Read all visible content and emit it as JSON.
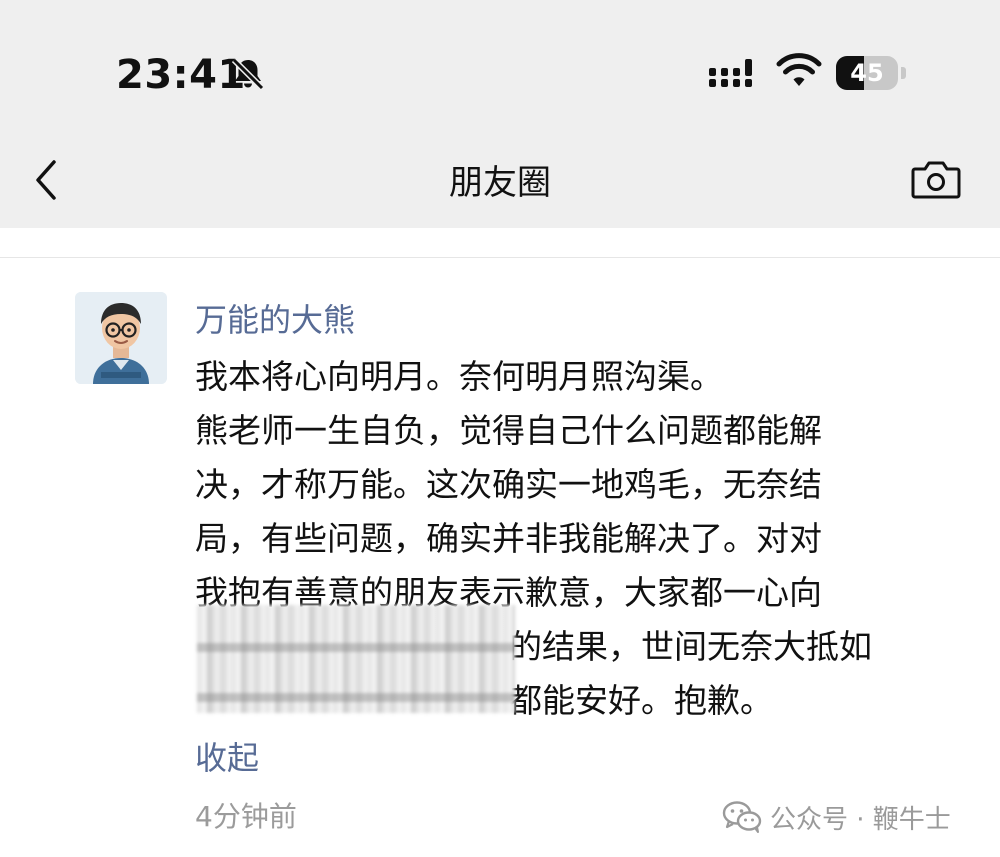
{
  "status_bar": {
    "time": "23:41",
    "battery_percent": 45,
    "battery_label": "45",
    "icons": [
      "bell-muted-icon",
      "signal-icon",
      "wifi-icon",
      "battery-icon"
    ]
  },
  "nav": {
    "title": "朋友圈",
    "back_icon": "chevron-left-icon",
    "camera_icon": "camera-icon"
  },
  "post": {
    "author": "万能的大熊",
    "lines": [
      "我本将心向明月。奈何明月照沟渠。",
      "熊老师一生自负，觉得自己什么问题都能解",
      "决，才称万能。这次确实一地鸡毛，无奈结",
      "局，有些问题，确实并非我能解决了。对对",
      "我抱有善意的朋友表示歉意，大家都一心向",
      "的结果，世间无奈大抵如",
      "都能安好。抱歉。"
    ],
    "collapse_label": "收起",
    "time_ago": "4分钟前"
  },
  "watermark": {
    "text": "公众号 · 鞭牛士",
    "icon": "wechat-icon"
  },
  "colors": {
    "link_blue": "#576b95",
    "header_bg": "#efefef",
    "meta_gray": "#9b9b9b"
  }
}
